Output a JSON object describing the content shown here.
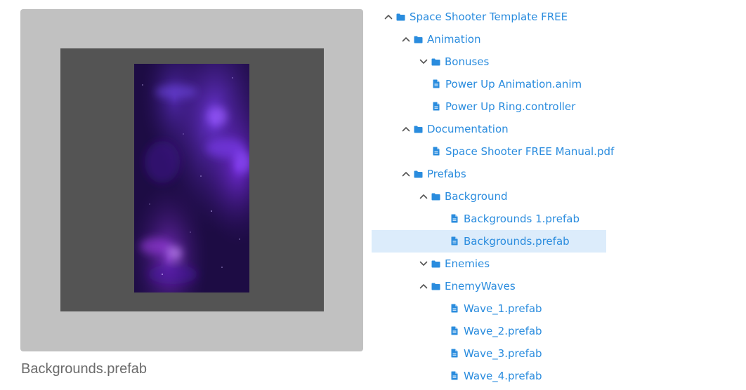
{
  "preview": {
    "caption": "Backgrounds.prefab"
  },
  "colors": {
    "accent": "#2a8cde",
    "selected_bg": "#dcecfb",
    "frame_bg": "#c1c1c1",
    "inner_bg": "#545454"
  },
  "tree": {
    "items": [
      {
        "label": "Space Shooter Template FREE",
        "type": "folder",
        "expanded": true,
        "depth": 0
      },
      {
        "label": "Animation",
        "type": "folder",
        "expanded": true,
        "depth": 1
      },
      {
        "label": "Bonuses",
        "type": "folder",
        "expanded": false,
        "depth": 2
      },
      {
        "label": "Power Up Animation.anim",
        "type": "file",
        "depth": 2
      },
      {
        "label": "Power Up Ring.controller",
        "type": "file",
        "depth": 2
      },
      {
        "label": "Documentation",
        "type": "folder",
        "expanded": true,
        "depth": 1
      },
      {
        "label": "Space Shooter FREE Manual.pdf",
        "type": "file",
        "depth": 2
      },
      {
        "label": "Prefabs",
        "type": "folder",
        "expanded": true,
        "depth": 1
      },
      {
        "label": "Background",
        "type": "folder",
        "expanded": true,
        "depth": 2
      },
      {
        "label": "Backgrounds 1.prefab",
        "type": "file",
        "depth": 3
      },
      {
        "label": "Backgrounds.prefab",
        "type": "file",
        "depth": 3,
        "selected": true
      },
      {
        "label": "Enemies",
        "type": "folder",
        "expanded": false,
        "depth": 2
      },
      {
        "label": "EnemyWaves",
        "type": "folder",
        "expanded": true,
        "depth": 2
      },
      {
        "label": "Wave_1.prefab",
        "type": "file",
        "depth": 3
      },
      {
        "label": "Wave_2.prefab",
        "type": "file",
        "depth": 3
      },
      {
        "label": "Wave_3.prefab",
        "type": "file",
        "depth": 3
      },
      {
        "label": "Wave_4.prefab",
        "type": "file",
        "depth": 3
      }
    ]
  }
}
